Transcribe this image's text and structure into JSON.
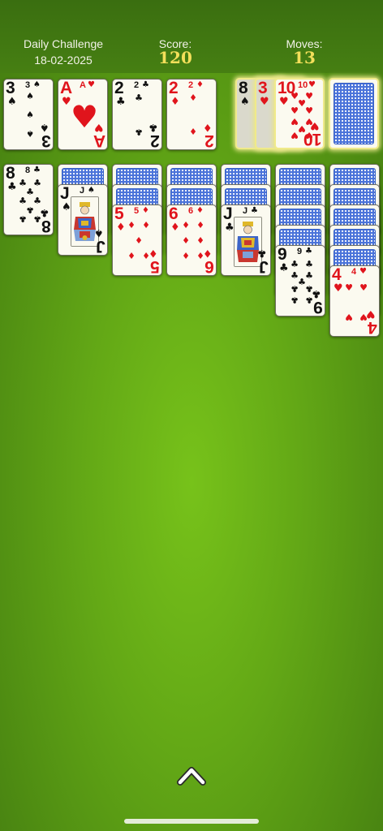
{
  "header": {
    "challenge_label": "Daily Challenge",
    "date": "18-02-2025",
    "score_label": "Score:",
    "score_value": "120",
    "moves_label": "Moves:",
    "moves_value": "13"
  },
  "colors": {
    "felt": "#63a816",
    "score_text": "#f3df5a",
    "card_back": "#4a73d9",
    "red_suit": "#e0141c"
  },
  "foundations": [
    {
      "rank": "3",
      "suit": "♠",
      "color": "black"
    },
    {
      "rank": "A",
      "suit": "♥",
      "color": "red"
    },
    {
      "rank": "2",
      "suit": "♣",
      "color": "black"
    },
    {
      "rank": "2",
      "suit": "♦",
      "color": "red"
    }
  ],
  "waste": [
    {
      "rank": "8",
      "suit": "♠",
      "color": "black"
    },
    {
      "rank": "3",
      "suit": "♥",
      "color": "red"
    },
    {
      "rank": "10",
      "suit": "♥",
      "color": "red"
    }
  ],
  "stock": {
    "icon": "card-back"
  },
  "tableau": [
    {
      "rank": "8",
      "suit": "♣",
      "color": "black"
    },
    {
      "rank": "J",
      "suit": "♠",
      "color": "black"
    },
    {
      "rank": "5",
      "suit": "♦",
      "color": "red"
    },
    {
      "rank": "6",
      "suit": "♦",
      "color": "red"
    },
    {
      "rank": "J",
      "suit": "♣",
      "color": "black"
    },
    {
      "rank": "9",
      "suit": "♣",
      "color": "black"
    },
    {
      "rank": "4",
      "suit": "♥",
      "color": "red"
    }
  ],
  "controls": {
    "menu_icon": "chevron-up-icon"
  }
}
